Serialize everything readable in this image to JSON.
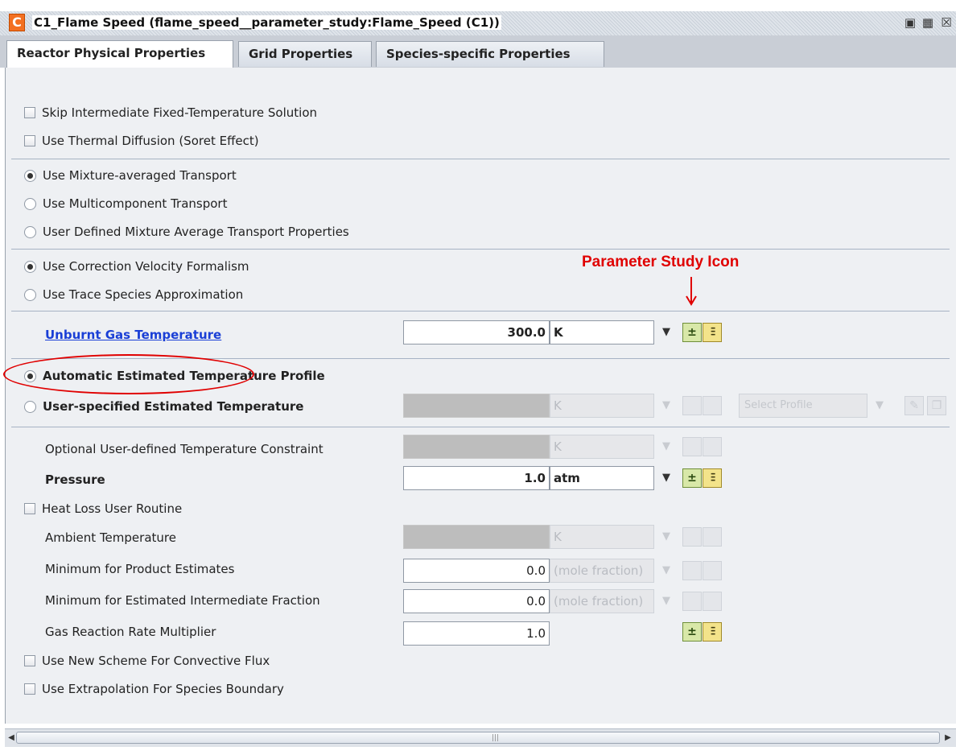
{
  "window": {
    "logo": "C",
    "title": "C1_Flame Speed  (flame_speed__parameter_study:Flame_Speed (C1))",
    "controls": [
      "minimize-icon",
      "maximize-icon",
      "close-icon"
    ]
  },
  "tabs": [
    {
      "label": "Reactor Physical Properties",
      "active": true
    },
    {
      "label": "Grid Properties",
      "active": false
    },
    {
      "label": "Species-specific Properties",
      "active": false
    }
  ],
  "options": {
    "skip_fixed_temp": {
      "label": "Skip Intermediate Fixed-Temperature Solution",
      "checked": false
    },
    "thermal_diffusion": {
      "label": "Use Thermal Diffusion (Soret Effect)",
      "checked": false
    },
    "transport": [
      {
        "label": "Use Mixture-averaged Transport",
        "selected": true
      },
      {
        "label": "Use Multicomponent Transport",
        "selected": false
      },
      {
        "label": "User Defined Mixture Average Transport Properties",
        "selected": false
      }
    ],
    "velocity": [
      {
        "label": "Use Correction Velocity Formalism",
        "selected": true
      },
      {
        "label": "Use Trace Species Approximation",
        "selected": false
      }
    ],
    "profile": [
      {
        "label": "Automatic Estimated Temperature Profile",
        "selected": true
      },
      {
        "label": "User-specified Estimated Temperature",
        "selected": false
      }
    ],
    "heat_loss": {
      "label": "Heat Loss User Routine",
      "checked": false
    },
    "convective_flux": {
      "label": "Use New Scheme For Convective Flux",
      "checked": false
    },
    "extrapolation": {
      "label": "Use Extrapolation For Species Boundary",
      "checked": false
    }
  },
  "fields": {
    "unburnt_gas_temp": {
      "label": "Unburnt Gas Temperature",
      "value": "300.0",
      "unit": "K"
    },
    "user_specified_temp": {
      "unit": "K",
      "profile_select": "Select Profile"
    },
    "temp_constraint": {
      "label": "Optional User-defined Temperature Constraint",
      "unit": "K"
    },
    "pressure": {
      "label": "Pressure",
      "value": "1.0",
      "unit": "atm"
    },
    "ambient_temp": {
      "label": "Ambient Temperature",
      "unit": "K"
    },
    "min_product": {
      "label": "Minimum for Product Estimates",
      "value": "0.0",
      "unit": "(mole fraction)"
    },
    "min_intermediate": {
      "label": "Minimum for Estimated Intermediate Fraction",
      "value": "0.0",
      "unit": "(mole fraction)"
    },
    "rate_multiplier": {
      "label": "Gas Reaction Rate Multiplier",
      "value": "1.0"
    }
  },
  "annotation": {
    "callout": "Parameter Study Icon"
  },
  "glyphs": {
    "plus_minus": "±",
    "sliders": "⫶⫶⫶",
    "dropdown": "▼",
    "left": "◀",
    "right": "▶",
    "grip": "|||"
  },
  "colors": {
    "annotation_red": "#e00000",
    "link_blue": "#1a3fd6",
    "brand_orange": "#f37021"
  }
}
